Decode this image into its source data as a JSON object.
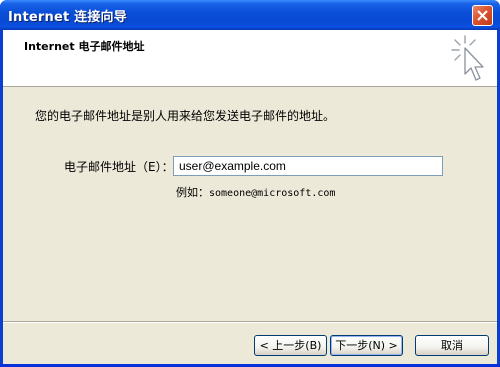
{
  "window": {
    "title": "Internet 连接向导"
  },
  "header": {
    "title": "Internet 电子邮件地址"
  },
  "body": {
    "instruction": "您的电子邮件地址是别人用来给您发送电子邮件的地址。",
    "email_label": "电子邮件地址（E）：",
    "email_value": "user@example.com",
    "example_prefix": "例如：",
    "example_address": "someone@microsoft.com"
  },
  "buttons": {
    "back": "< 上一步(B)",
    "next": "下一步(N) >",
    "cancel": "取消"
  },
  "icons": {
    "close": "close-icon",
    "wizard": "wizard-cursor-icon"
  },
  "colors": {
    "titlebar": "#0a4fd9",
    "client_bg": "#ece9d8",
    "close_button": "#d9542f"
  }
}
